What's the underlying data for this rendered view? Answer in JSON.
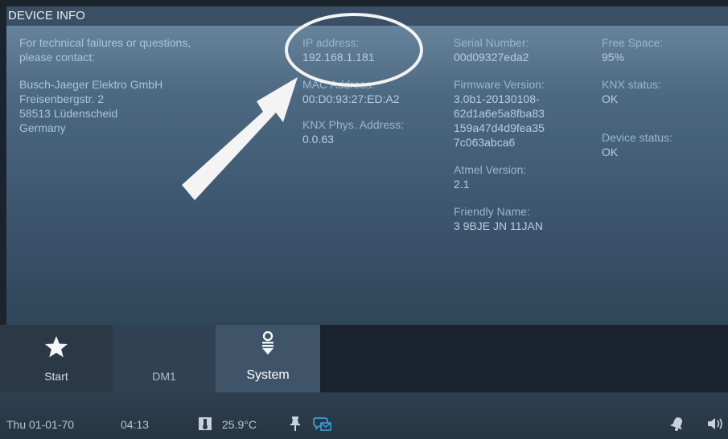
{
  "header": {
    "title": "DEVICE INFO"
  },
  "contact": {
    "intro": [
      "For technical failures or questions,",
      "please contact:"
    ],
    "address": [
      "Busch-Jaeger Elektro GmbH",
      "Freisenbergstr. 2",
      "58513 Lüdenscheid",
      "Germany"
    ]
  },
  "network": {
    "ip_label": "IP address:",
    "ip_value": "192.168.1.181",
    "mac_label": "MAC Address:",
    "mac_value": "00:D0:93:27:ED:A2",
    "knx_phys_label": "KNX Phys. Address:",
    "knx_phys_value": "0.0.63"
  },
  "device": {
    "serial_label": "Serial Number:",
    "serial_value": "00d09327eda2",
    "firmware_label": "Firmware Version:",
    "firmware_value": [
      "3.0b1-20130108-",
      "62d1a6e5a8fba83",
      "159a47d4d9fea35",
      "7c063abca6"
    ],
    "atmel_label": "Atmel Version:",
    "atmel_value": "2.1",
    "friendly_label": "Friendly Name:",
    "friendly_value": "3 9BJE JN 11JAN"
  },
  "status_info": {
    "free_space_label": "Free Space:",
    "free_space_value": "95%",
    "knx_status_label": "KNX status:",
    "knx_status_value": "OK",
    "device_status_label": "Device status:",
    "device_status_value": "OK"
  },
  "nav": {
    "start_label": "Start",
    "start_icon": "star-icon",
    "dm1_label": "DM1",
    "system_label": "System",
    "system_icon": "system-icon"
  },
  "statusbar": {
    "date": "Thu 01-01-70",
    "time": "04:13",
    "temperature": "25.9°C",
    "icons": [
      "thermometer-icon",
      "pin-icon",
      "message-icon",
      "bell-icon",
      "speaker-icon"
    ]
  },
  "colors": {
    "accent": "#3aa0d8",
    "panel": "#4d6881",
    "nav_active": "#3f5468"
  }
}
